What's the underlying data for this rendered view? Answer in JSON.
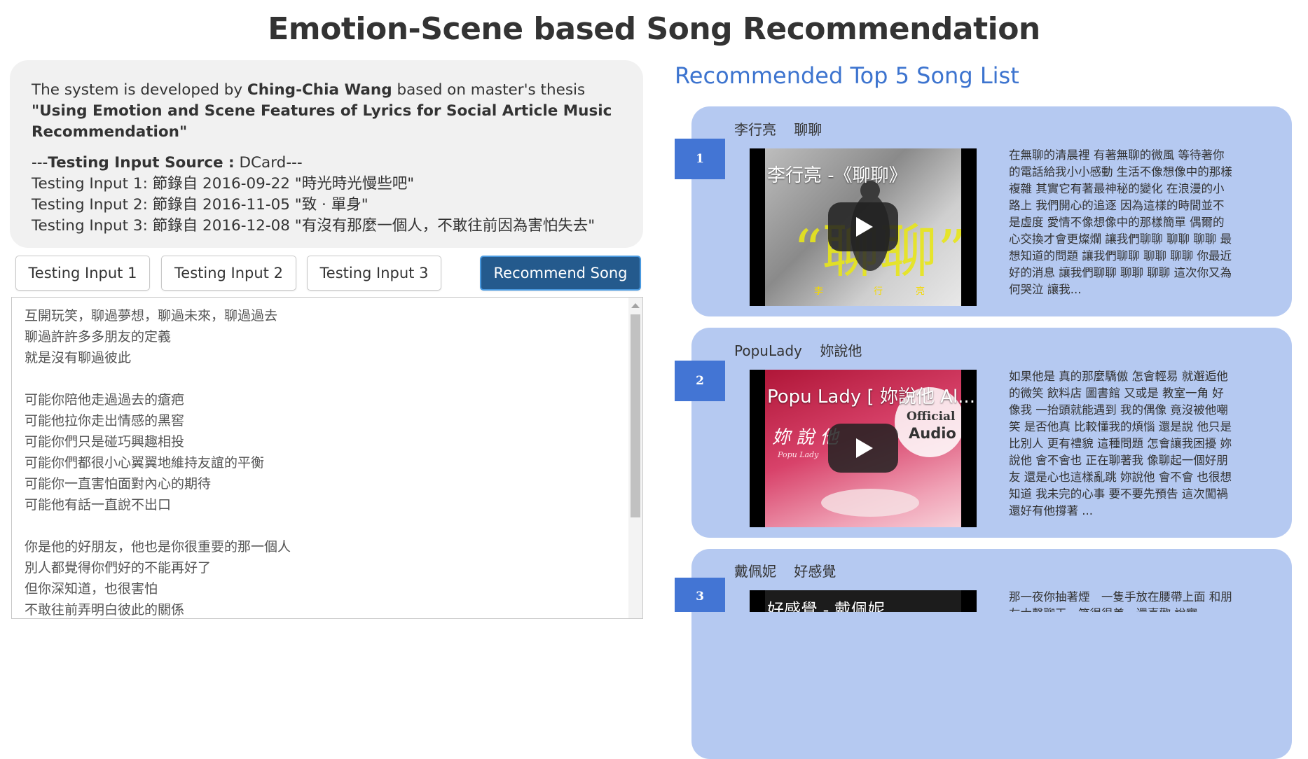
{
  "page": {
    "title": "Emotion-Scene based Song Recommendation"
  },
  "info": {
    "intro_prefix": "The system is developed by ",
    "author": "Ching-Chia Wang",
    "intro_mid": " based on master's thesis ",
    "thesis": "\"Using Emotion and Scene Features of Lyrics for Social Article Music Recommendation\"",
    "source_prefix": "---",
    "source_label": "Testing Input Source :",
    "source_value": " DCard---",
    "inputs": [
      "Testing Input 1: 節錄自 2016-09-22 \"時光時光慢些吧\"",
      "Testing Input 2: 節錄自 2016-11-05 \"致 · 單身\"",
      "Testing Input 3: 節錄自 2016-12-08 \"有沒有那麼一個人，不敢往前因為害怕失去\""
    ]
  },
  "buttons": {
    "input1": "Testing Input 1",
    "input2": "Testing Input 2",
    "input3": "Testing Input 3",
    "recommend": "Recommend Song"
  },
  "textarea": {
    "content": "互開玩笑，聊過夢想，聊過未來，聊過過去\n聊過許許多多朋友的定義\n就是沒有聊過彼此\n\n可能你陪他走過過去的瘡疤\n可能他拉你走出情感的黑窖\n可能你們只是碰巧興趣相投\n可能你們都很小心翼翼地維持友誼的平衡\n可能你一直害怕面對內心的期待\n可能他有話一直說不出口\n\n你是他的好朋友，他也是你很重要的那一個人\n別人都覺得你們好的不能再好了\n但你深知道，也很害怕\n不敢往前弄明白彼此的關係"
  },
  "recommendations": {
    "heading": "Recommended Top 5 Song List",
    "songs": [
      {
        "rank": "1",
        "header": "李行亮    聊聊",
        "video_title": "李行亮 -《聊聊》",
        "lyrics": "在無聊的清晨裡 有著無聊的微風 等待著你的電話給我小小感動 生活不像想像中的那樣複雜 其實它有著最神秘的變化 在浪漫的小路上 我們開心的追逐 因為這樣的時間並不是虛度 愛情不像想像中的那樣簡單 偶爾的心交換才會更燦爛 讓我們聊聊 聊聊 聊聊 最想知道的問題 讓我們聊聊 聊聊 聊聊 你最近好的消息 讓我們聊聊 聊聊 聊聊 這次你又為何哭泣 讓我..."
      },
      {
        "rank": "2",
        "header": "PopuLady    妳說他",
        "video_title": "Popu Lady [ 妳說他 Al...",
        "lyrics": "如果他是 真的那麼驕傲 怎會輕易 就邂逅他的微笑 飲料店 圖書館 又或是 教室一角 好像我 一抬頭就能遇到 我的偶像 竟沒被他嘲笑 是否他真 比較懂我的煩惱 還是說 他只是 比別人 更有禮貌 這種問題 怎會讓我困擾 妳說他 會不會也 正在聊著我 像聊起一個好朋友 還是心也這樣亂跳 妳說他 會不會 也很想知道 我未完的心事 要不要先預告 這次闖禍 還好有他撐著 ..."
      },
      {
        "rank": "3",
        "header": "戴佩妮    好感覺",
        "video_title": "好感覺 - 戴佩妮",
        "lyrics": "那一夜你抽著煙　一隻手放在腰帶上面 和朋友大聲聊天　笑得很美　還喜歡 說實..."
      }
    ]
  }
}
